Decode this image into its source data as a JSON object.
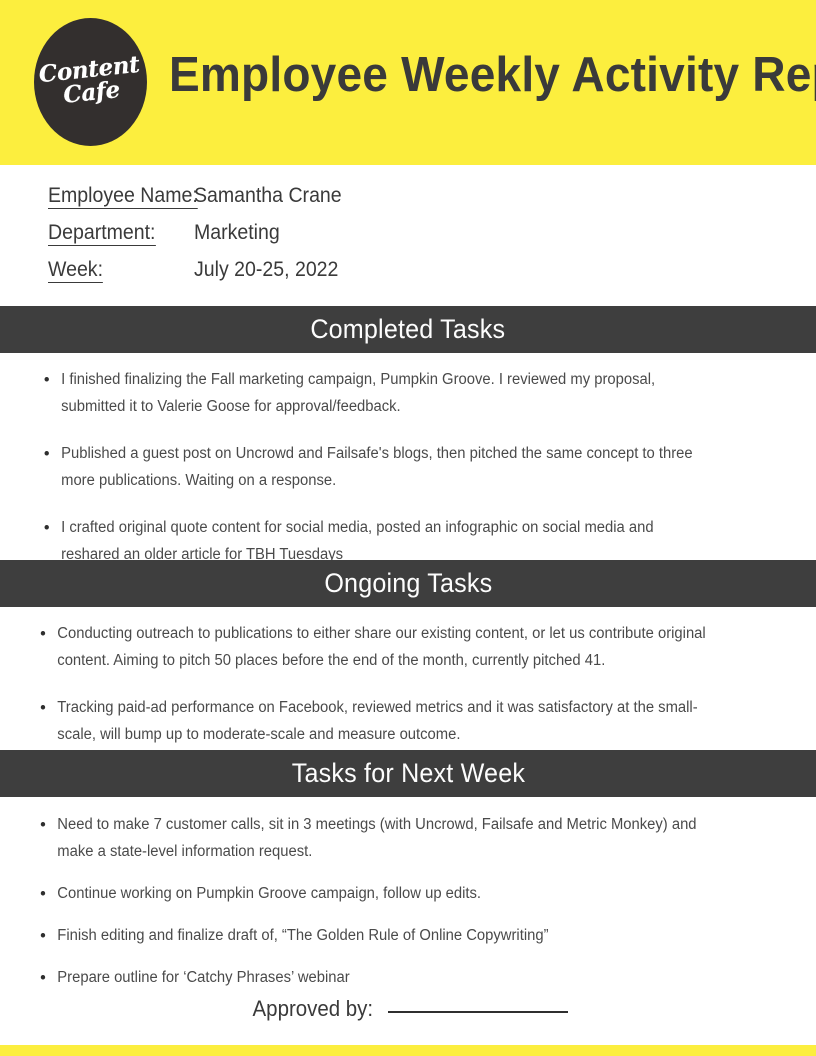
{
  "header": {
    "title": "Employee Weekly Activity Report",
    "logo": {
      "line1": "Content",
      "line2": "Cafe"
    },
    "background_color": "#fcee3e",
    "logo_color": "#332f2e"
  },
  "info": {
    "rows": [
      {
        "label": "Employee Name:",
        "value": "Samantha Crane"
      },
      {
        "label": "Department:",
        "value": "Marketing"
      },
      {
        "label": "Week: ",
        "value": "July 20-25, 2022"
      }
    ]
  },
  "sections": [
    {
      "title": "Completed Tasks",
      "items": [
        "I finished finalizing the Fall marketing campaign, Pumpkin Groove. I reviewed my proposal, submitted it to Valerie Goose for approval/feedback.",
        "Published a guest post on Uncrowd and Failsafe's blogs, then pitched the same concept to three more publications. Waiting on a response.",
        "I crafted original quote content for social media, posted an infographic on social media and reshared an older article for TBH Tuesdays"
      ]
    },
    {
      "title": "Ongoing Tasks",
      "items": [
        "Conducting outreach to publications to either share our existing content, or let us contribute original content. Aiming to pitch 50 places before the end of the month, currently pitched 41.",
        "Tracking paid-ad performance on Facebook, reviewed metrics and it was satisfactory at the small-scale, will bump up to moderate-scale and measure outcome."
      ]
    },
    {
      "title": "Tasks for Next Week",
      "items": [
        "Need to make 7 customer calls, sit in 3 meetings (with Uncrowd, Failsafe and Metric Monkey) and make a state-level information request.",
        "Continue working on Pumpkin Groove campaign, follow up edits.",
        "Finish editing and finalize draft of, “The Golden Rule of Online Copywriting”",
        "Prepare outline for ‘Catchy Phrases’ webinar"
      ]
    }
  ],
  "approval": {
    "label": "Approved by:",
    "signature_value": ""
  },
  "colors": {
    "accent_yellow": "#fcee3e",
    "bar_dark": "#3e3e3e",
    "text_dark": "#3a3a3a",
    "body_text": "#4a4a4a"
  },
  "bullet_glyph": "•"
}
